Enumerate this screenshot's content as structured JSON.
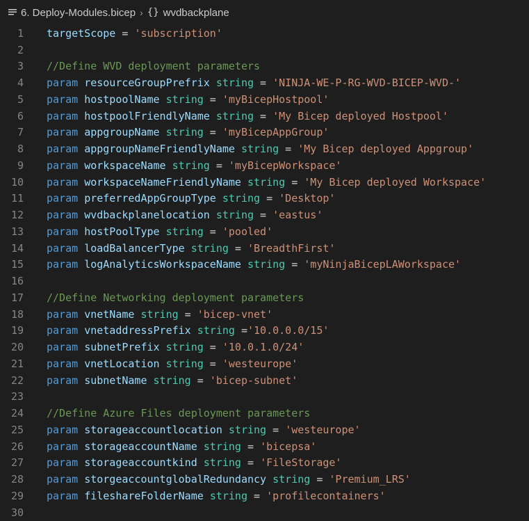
{
  "breadcrumb": {
    "file": "6. Deploy-Modules.bicep",
    "symbol": "wvdbackplane"
  },
  "lines": [
    {
      "num": "1",
      "tokens": [
        {
          "t": "id",
          "v": "targetScope"
        },
        {
          "t": "op",
          "v": " = "
        },
        {
          "t": "st",
          "v": "'subscription'"
        }
      ]
    },
    {
      "num": "2",
      "tokens": []
    },
    {
      "num": "3",
      "tokens": [
        {
          "t": "cm",
          "v": "//Define WVD deployment parameters"
        }
      ]
    },
    {
      "num": "4",
      "tokens": [
        {
          "t": "kw",
          "v": "param"
        },
        {
          "t": "op",
          "v": " "
        },
        {
          "t": "id",
          "v": "resourceGroupPrefrix"
        },
        {
          "t": "op",
          "v": " "
        },
        {
          "t": "ty",
          "v": "string"
        },
        {
          "t": "op",
          "v": " = "
        },
        {
          "t": "st",
          "v": "'NINJA-WE-P-RG-WVD-BICEP-WVD-'"
        }
      ]
    },
    {
      "num": "5",
      "tokens": [
        {
          "t": "kw",
          "v": "param"
        },
        {
          "t": "op",
          "v": " "
        },
        {
          "t": "id",
          "v": "hostpoolName"
        },
        {
          "t": "op",
          "v": " "
        },
        {
          "t": "ty",
          "v": "string"
        },
        {
          "t": "op",
          "v": " = "
        },
        {
          "t": "st",
          "v": "'myBicepHostpool'"
        }
      ]
    },
    {
      "num": "6",
      "tokens": [
        {
          "t": "kw",
          "v": "param"
        },
        {
          "t": "op",
          "v": " "
        },
        {
          "t": "id",
          "v": "hostpoolFriendlyName"
        },
        {
          "t": "op",
          "v": " "
        },
        {
          "t": "ty",
          "v": "string"
        },
        {
          "t": "op",
          "v": " = "
        },
        {
          "t": "st",
          "v": "'My Bicep deployed Hostpool'"
        }
      ]
    },
    {
      "num": "7",
      "tokens": [
        {
          "t": "kw",
          "v": "param"
        },
        {
          "t": "op",
          "v": " "
        },
        {
          "t": "id",
          "v": "appgroupName"
        },
        {
          "t": "op",
          "v": " "
        },
        {
          "t": "ty",
          "v": "string"
        },
        {
          "t": "op",
          "v": " = "
        },
        {
          "t": "st",
          "v": "'myBicepAppGroup'"
        }
      ]
    },
    {
      "num": "8",
      "tokens": [
        {
          "t": "kw",
          "v": "param"
        },
        {
          "t": "op",
          "v": " "
        },
        {
          "t": "id",
          "v": "appgroupNameFriendlyName"
        },
        {
          "t": "op",
          "v": " "
        },
        {
          "t": "ty",
          "v": "string"
        },
        {
          "t": "op",
          "v": " = "
        },
        {
          "t": "st",
          "v": "'My Bicep deployed Appgroup'"
        }
      ]
    },
    {
      "num": "9",
      "tokens": [
        {
          "t": "kw",
          "v": "param"
        },
        {
          "t": "op",
          "v": " "
        },
        {
          "t": "id",
          "v": "workspaceName"
        },
        {
          "t": "op",
          "v": " "
        },
        {
          "t": "ty",
          "v": "string"
        },
        {
          "t": "op",
          "v": " = "
        },
        {
          "t": "st",
          "v": "'myBicepWorkspace'"
        }
      ]
    },
    {
      "num": "10",
      "tokens": [
        {
          "t": "kw",
          "v": "param"
        },
        {
          "t": "op",
          "v": " "
        },
        {
          "t": "id",
          "v": "workspaceNameFriendlyName"
        },
        {
          "t": "op",
          "v": " "
        },
        {
          "t": "ty",
          "v": "string"
        },
        {
          "t": "op",
          "v": " = "
        },
        {
          "t": "st",
          "v": "'My Bicep deployed Workspace'"
        }
      ]
    },
    {
      "num": "11",
      "tokens": [
        {
          "t": "kw",
          "v": "param"
        },
        {
          "t": "op",
          "v": " "
        },
        {
          "t": "id",
          "v": "preferredAppGroupType"
        },
        {
          "t": "op",
          "v": " "
        },
        {
          "t": "ty",
          "v": "string"
        },
        {
          "t": "op",
          "v": " = "
        },
        {
          "t": "st",
          "v": "'Desktop'"
        }
      ]
    },
    {
      "num": "12",
      "tokens": [
        {
          "t": "kw",
          "v": "param"
        },
        {
          "t": "op",
          "v": " "
        },
        {
          "t": "id",
          "v": "wvdbackplanelocation"
        },
        {
          "t": "op",
          "v": " "
        },
        {
          "t": "ty",
          "v": "string"
        },
        {
          "t": "op",
          "v": " = "
        },
        {
          "t": "st",
          "v": "'eastus'"
        }
      ]
    },
    {
      "num": "13",
      "tokens": [
        {
          "t": "kw",
          "v": "param"
        },
        {
          "t": "op",
          "v": " "
        },
        {
          "t": "id",
          "v": "hostPoolType"
        },
        {
          "t": "op",
          "v": " "
        },
        {
          "t": "ty",
          "v": "string"
        },
        {
          "t": "op",
          "v": " = "
        },
        {
          "t": "st",
          "v": "'pooled'"
        }
      ]
    },
    {
      "num": "14",
      "tokens": [
        {
          "t": "kw",
          "v": "param"
        },
        {
          "t": "op",
          "v": " "
        },
        {
          "t": "id",
          "v": "loadBalancerType"
        },
        {
          "t": "op",
          "v": " "
        },
        {
          "t": "ty",
          "v": "string"
        },
        {
          "t": "op",
          "v": " = "
        },
        {
          "t": "st",
          "v": "'BreadthFirst'"
        }
      ]
    },
    {
      "num": "15",
      "tokens": [
        {
          "t": "kw",
          "v": "param"
        },
        {
          "t": "op",
          "v": " "
        },
        {
          "t": "id",
          "v": "logAnalyticsWorkspaceName"
        },
        {
          "t": "op",
          "v": " "
        },
        {
          "t": "ty",
          "v": "string"
        },
        {
          "t": "op",
          "v": " = "
        },
        {
          "t": "st",
          "v": "'myNinjaBicepLAWorkspace'"
        }
      ]
    },
    {
      "num": "16",
      "tokens": []
    },
    {
      "num": "17",
      "tokens": [
        {
          "t": "cm",
          "v": "//Define Networking deployment parameters"
        }
      ]
    },
    {
      "num": "18",
      "tokens": [
        {
          "t": "kw",
          "v": "param"
        },
        {
          "t": "op",
          "v": " "
        },
        {
          "t": "id",
          "v": "vnetName"
        },
        {
          "t": "op",
          "v": " "
        },
        {
          "t": "ty",
          "v": "string"
        },
        {
          "t": "op",
          "v": " = "
        },
        {
          "t": "st",
          "v": "'bicep-vnet'"
        }
      ]
    },
    {
      "num": "19",
      "tokens": [
        {
          "t": "kw",
          "v": "param"
        },
        {
          "t": "op",
          "v": " "
        },
        {
          "t": "id",
          "v": "vnetaddressPrefix"
        },
        {
          "t": "op",
          "v": " "
        },
        {
          "t": "ty",
          "v": "string"
        },
        {
          "t": "op",
          "v": " ="
        },
        {
          "t": "st",
          "v": "'10.0.0.0/15'"
        }
      ]
    },
    {
      "num": "20",
      "tokens": [
        {
          "t": "kw",
          "v": "param"
        },
        {
          "t": "op",
          "v": " "
        },
        {
          "t": "id",
          "v": "subnetPrefix"
        },
        {
          "t": "op",
          "v": " "
        },
        {
          "t": "ty",
          "v": "string"
        },
        {
          "t": "op",
          "v": " = "
        },
        {
          "t": "st",
          "v": "'10.0.1.0/24'"
        }
      ]
    },
    {
      "num": "21",
      "tokens": [
        {
          "t": "kw",
          "v": "param"
        },
        {
          "t": "op",
          "v": " "
        },
        {
          "t": "id",
          "v": "vnetLocation"
        },
        {
          "t": "op",
          "v": " "
        },
        {
          "t": "ty",
          "v": "string"
        },
        {
          "t": "op",
          "v": " = "
        },
        {
          "t": "st",
          "v": "'westeurope'"
        }
      ]
    },
    {
      "num": "22",
      "tokens": [
        {
          "t": "kw",
          "v": "param"
        },
        {
          "t": "op",
          "v": " "
        },
        {
          "t": "id",
          "v": "subnetName"
        },
        {
          "t": "op",
          "v": " "
        },
        {
          "t": "ty",
          "v": "string"
        },
        {
          "t": "op",
          "v": " = "
        },
        {
          "t": "st",
          "v": "'bicep-subnet'"
        }
      ]
    },
    {
      "num": "23",
      "tokens": []
    },
    {
      "num": "24",
      "tokens": [
        {
          "t": "cm",
          "v": "//Define Azure Files deployment parameters"
        }
      ]
    },
    {
      "num": "25",
      "tokens": [
        {
          "t": "kw",
          "v": "param"
        },
        {
          "t": "op",
          "v": " "
        },
        {
          "t": "id",
          "v": "storageaccountlocation"
        },
        {
          "t": "op",
          "v": " "
        },
        {
          "t": "ty",
          "v": "string"
        },
        {
          "t": "op",
          "v": " = "
        },
        {
          "t": "st",
          "v": "'westeurope'"
        }
      ]
    },
    {
      "num": "26",
      "tokens": [
        {
          "t": "kw",
          "v": "param"
        },
        {
          "t": "op",
          "v": " "
        },
        {
          "t": "id",
          "v": "storageaccountName"
        },
        {
          "t": "op",
          "v": " "
        },
        {
          "t": "ty",
          "v": "string"
        },
        {
          "t": "op",
          "v": " = "
        },
        {
          "t": "st",
          "v": "'bicepsa'"
        }
      ]
    },
    {
      "num": "27",
      "tokens": [
        {
          "t": "kw",
          "v": "param"
        },
        {
          "t": "op",
          "v": " "
        },
        {
          "t": "id",
          "v": "storageaccountkind"
        },
        {
          "t": "op",
          "v": " "
        },
        {
          "t": "ty",
          "v": "string"
        },
        {
          "t": "op",
          "v": " = "
        },
        {
          "t": "st",
          "v": "'FileStorage'"
        }
      ]
    },
    {
      "num": "28",
      "tokens": [
        {
          "t": "kw",
          "v": "param"
        },
        {
          "t": "op",
          "v": " "
        },
        {
          "t": "id",
          "v": "storgeaccountglobalRedundancy"
        },
        {
          "t": "op",
          "v": " "
        },
        {
          "t": "ty",
          "v": "string"
        },
        {
          "t": "op",
          "v": " = "
        },
        {
          "t": "st",
          "v": "'Premium_LRS'"
        }
      ]
    },
    {
      "num": "29",
      "tokens": [
        {
          "t": "kw",
          "v": "param"
        },
        {
          "t": "op",
          "v": " "
        },
        {
          "t": "id",
          "v": "fileshareFolderName"
        },
        {
          "t": "op",
          "v": " "
        },
        {
          "t": "ty",
          "v": "string"
        },
        {
          "t": "op",
          "v": " = "
        },
        {
          "t": "st",
          "v": "'profilecontainers'"
        }
      ]
    },
    {
      "num": "30",
      "tokens": []
    }
  ]
}
